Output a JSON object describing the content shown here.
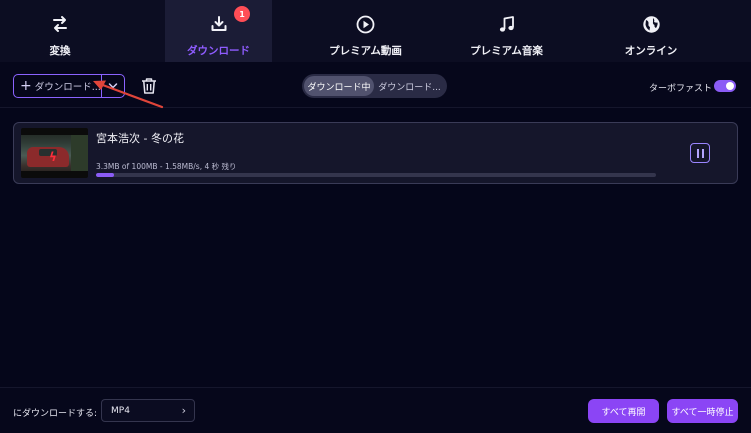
{
  "nav": {
    "tabs": [
      {
        "label": "変換",
        "icon": "convert-arrows-icon"
      },
      {
        "label": "ダウンロード",
        "icon": "download-icon",
        "badge": "1",
        "active": true
      },
      {
        "label": "プレミアム動画",
        "icon": "play-circle-icon"
      },
      {
        "label": "プレミアム音楽",
        "icon": "music-note-icon"
      },
      {
        "label": "オンライン",
        "icon": "globe-icon"
      }
    ]
  },
  "toolbar": {
    "download_button_label": "ダウンロード...",
    "segments": [
      "ダウンロード中",
      "ダウンロード..."
    ],
    "active_segment": "ダウンロード中",
    "turbo_label": "ターボファスト",
    "turbo_enabled": true
  },
  "downloads": [
    {
      "title": "宮本浩次 - 冬の花",
      "stats": "3.3MB of 100MB -   1.58MB/s, 4 秒 残り",
      "progress_fraction": 0.033
    }
  ],
  "footer": {
    "convert_label": "にダウンロードする:",
    "format": "MP4",
    "resume_all": "すべて再開",
    "pause_all": "すべて一時停止"
  },
  "colors": {
    "accent": "#8b5cf6",
    "badge": "#ff4d56",
    "annotation_arrow": "#e0453a"
  }
}
